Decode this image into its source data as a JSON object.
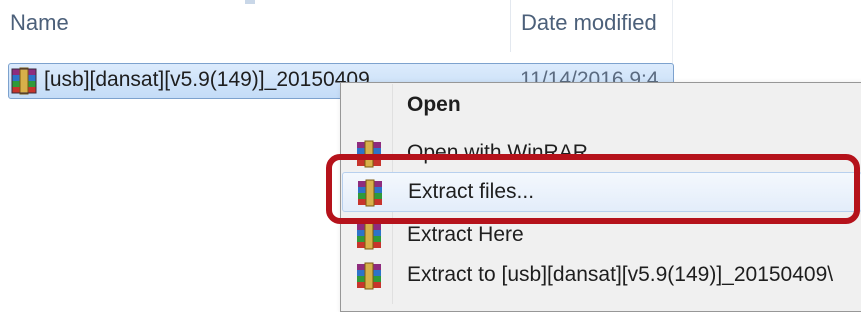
{
  "explorer": {
    "columns": {
      "name": "Name",
      "date_modified": "Date modified"
    },
    "file": {
      "name": "[usb][dansat][v5.9(149)]_20150409",
      "date_modified": "11/14/2016 9:4"
    }
  },
  "context_menu": {
    "items": [
      {
        "label": "Open",
        "icon": "none",
        "bold": true
      },
      {
        "label": "Open with WinRAR",
        "icon": "winrar-icon"
      },
      {
        "label": "Extract files...",
        "icon": "winrar-icon",
        "highlighted": true
      },
      {
        "label": "Extract Here",
        "icon": "winrar-icon"
      },
      {
        "label": "Extract to [usb][dansat][v5.9(149)]_20150409\\",
        "icon": "winrar-icon"
      }
    ]
  },
  "colors": {
    "selection": "#c4dcf7",
    "annotation": "#b5121b",
    "header_text": "#4c607a"
  }
}
